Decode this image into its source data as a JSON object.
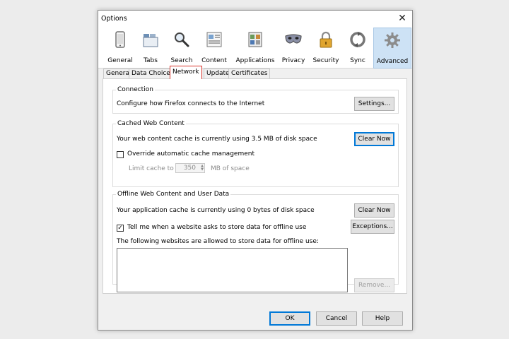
{
  "window": {
    "title": "Options",
    "close_glyph": "✕"
  },
  "toolbar": {
    "items": [
      {
        "label": "General",
        "icon": "phone-icon"
      },
      {
        "label": "Tabs",
        "icon": "tabs-icon"
      },
      {
        "label": "Search",
        "icon": "magnifier-icon"
      },
      {
        "label": "Content",
        "icon": "content-icon"
      },
      {
        "label": "Applications",
        "icon": "applications-icon"
      },
      {
        "label": "Privacy",
        "icon": "mask-icon"
      },
      {
        "label": "Security",
        "icon": "padlock-icon"
      },
      {
        "label": "Sync",
        "icon": "sync-icon"
      },
      {
        "label": "Advanced",
        "icon": "gear-icon",
        "active": true
      }
    ]
  },
  "tabs": {
    "items": [
      "General",
      "Data Choices",
      "Network",
      "Update",
      "Certificates"
    ],
    "active": "Network",
    "active_border_color": "#d9342b"
  },
  "connection": {
    "title": "Connection",
    "description": "Configure how Firefox connects to the Internet",
    "settings_button": "Settings..."
  },
  "cache": {
    "title": "Cached Web Content",
    "status": "Your web content cache is currently using 3.5 MB of disk space",
    "clear_button": "Clear Now",
    "override_label": "Override automatic cache management",
    "override_checked": false,
    "limit_label": "Limit cache to",
    "limit_value": "350",
    "limit_unit": "MB of space"
  },
  "offline": {
    "title": "Offline Web Content and User Data",
    "status": "Your application cache is currently using 0 bytes of disk space",
    "clear_button": "Clear Now",
    "tell_me_label": "Tell me when a website asks to store data for offline use",
    "tell_me_checked": true,
    "exceptions_button": "Exceptions...",
    "allowed_label": "The following websites are allowed to store data for offline use:",
    "remove_button": "Remove..."
  },
  "footer": {
    "ok": "OK",
    "cancel": "Cancel",
    "help": "Help"
  },
  "colors": {
    "focus": "#0078d7",
    "active_tool_bg": "#cde2f5"
  }
}
